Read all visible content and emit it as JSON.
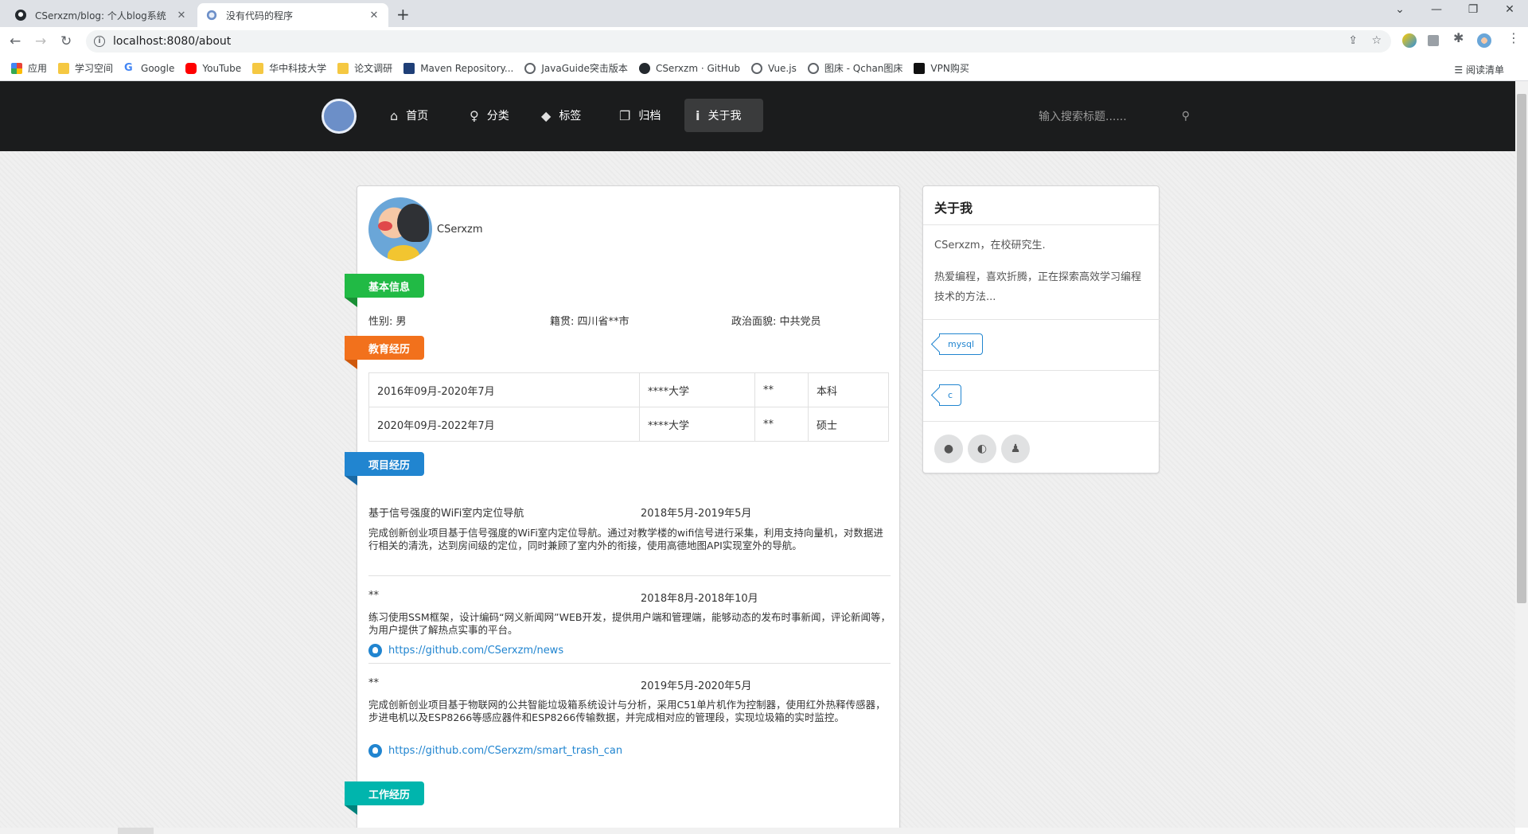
{
  "browser": {
    "tabs": [
      {
        "title": "CSerxzm/blog: 个人blog系统",
        "active": false
      },
      {
        "title": "没有代码的程序",
        "active": true
      }
    ],
    "new_tab": "+",
    "url": "localhost:8080/about",
    "bookmarks": [
      {
        "label": "应用",
        "icon": "apps-icon"
      },
      {
        "label": "学习空间",
        "icon": "folder-icon"
      },
      {
        "label": "Google",
        "icon": "google-icon"
      },
      {
        "label": "YouTube",
        "icon": "youtube-icon"
      },
      {
        "label": "华中科技大学",
        "icon": "folder-icon"
      },
      {
        "label": "论文调研",
        "icon": "folder-icon"
      },
      {
        "label": "Maven Repository...",
        "icon": "maven-icon"
      },
      {
        "label": "JavaGuide突击版本",
        "icon": "globe-icon"
      },
      {
        "label": "CSerxzm · GitHub",
        "icon": "github-icon"
      },
      {
        "label": "Vue.js",
        "icon": "globe-icon"
      },
      {
        "label": "图床 - Qchan图床",
        "icon": "globe-icon"
      },
      {
        "label": "VPN购买",
        "icon": "vpn-icon"
      }
    ],
    "reading_list": "阅读清单"
  },
  "nav": {
    "items": [
      {
        "label": "首页",
        "icon": "home-icon",
        "active": false
      },
      {
        "label": "分类",
        "icon": "lightbulb-icon",
        "active": false
      },
      {
        "label": "标签",
        "icon": "tags-icon",
        "active": false
      },
      {
        "label": "归档",
        "icon": "archive-icon",
        "active": false
      },
      {
        "label": "关于我",
        "icon": "info-icon",
        "active": true
      }
    ],
    "search_placeholder": "输入搜索标题......"
  },
  "profile": {
    "name": "CSerxzm",
    "sections": {
      "basic": "基本信息",
      "education": "教育经历",
      "projects": "项目经历",
      "work": "工作经历"
    },
    "basic_info": {
      "gender": "性别: 男",
      "origin": "籍贯: 四川省**市",
      "politics": "政治面貌: 中共党员"
    },
    "education": [
      {
        "period": "2016年09月-2020年7月",
        "school": "****大学",
        "major": "**",
        "degree": "本科"
      },
      {
        "period": "2020年09月-2022年7月",
        "school": "****大学",
        "major": "**",
        "degree": "硕士"
      }
    ],
    "projects": [
      {
        "title": "基于信号强度的WiFi室内定位导航",
        "date": "2018年5月-2019年5月",
        "desc": "完成创新创业项目基于信号强度的WiFi室内定位导航。通过对教学楼的wifi信号进行采集，利用支持向量机，对数据进行相关的清洗，达到房间级的定位，同时兼顾了室内外的衔接，使用高德地图API实现室外的导航。",
        "link": ""
      },
      {
        "title": "**",
        "date": "2018年8月-2018年10月",
        "desc": "练习使用SSM框架，设计编码“网义新闻网”WEB开发，提供用户端和管理端，能够动态的发布时事新闻，评论新闻等，为用户提供了解热点实事的平台。",
        "link": "https://github.com/CSerxzm/news"
      },
      {
        "title": "**",
        "date": "2019年5月-2020年5月",
        "desc": "完成创新创业项目基于物联网的公共智能垃圾箱系统设计与分析，采用C51单片机作为控制器，使用红外热释传感器，步进电机以及ESP8266等感应器件和ESP8266传输数据，并完成相对应的管理段，实现垃圾箱的实时监控。",
        "link": "https://github.com/CSerxzm/smart_trash_can"
      }
    ]
  },
  "sidebar": {
    "title": "关于我",
    "intro1": "CSerxzm，在校研究生.",
    "intro2": "热爱编程，喜欢折腾，正在探索高效学习编程技术的方法...",
    "tags": [
      "mysql",
      "c"
    ],
    "social": [
      "github-icon",
      "wechat-icon",
      "qq-icon"
    ]
  }
}
